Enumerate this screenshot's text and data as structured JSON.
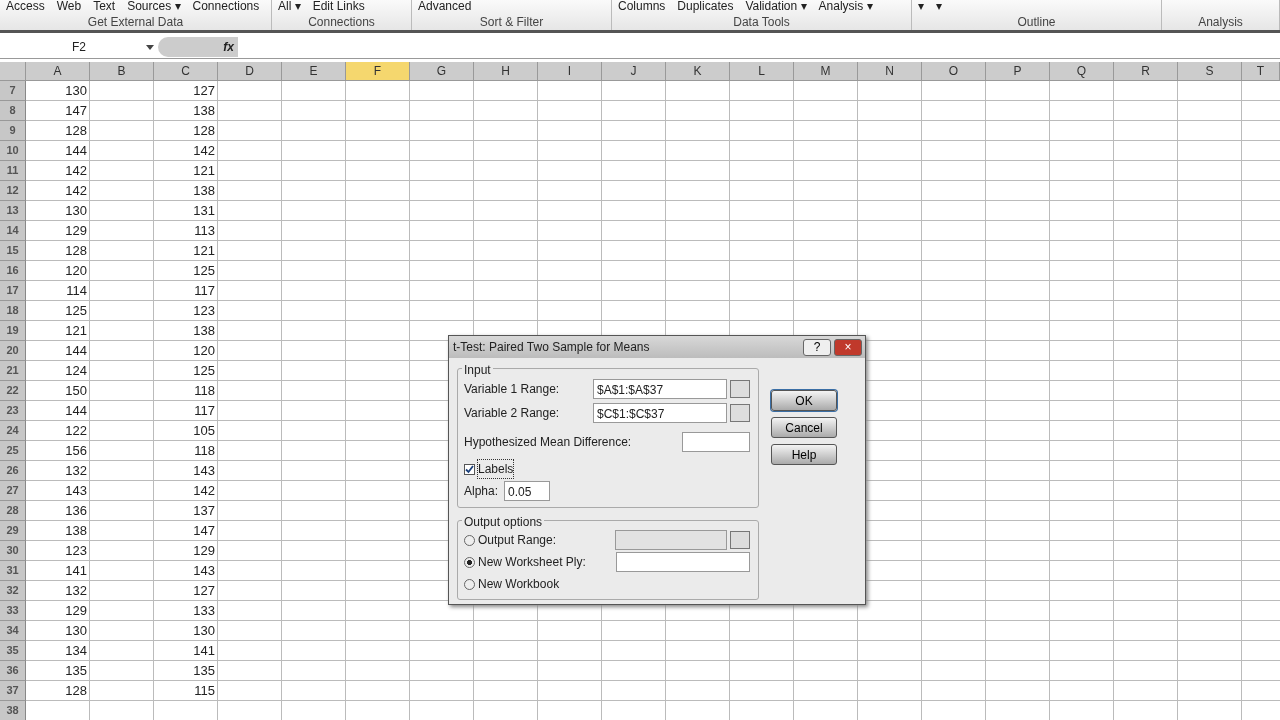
{
  "ribbon": {
    "groups": [
      {
        "label": "Get External Data",
        "items": [
          "Access",
          "Web",
          "Text",
          "Sources ▾",
          "Connections"
        ]
      },
      {
        "label": "Connections",
        "items": [
          "All ▾",
          "Edit Links"
        ]
      },
      {
        "label": "Sort & Filter",
        "items": [
          "Advanced"
        ]
      },
      {
        "label": "Data Tools",
        "items": [
          "Columns",
          "Duplicates",
          "Validation ▾",
          "Analysis ▾"
        ]
      },
      {
        "label": "Outline",
        "items": [
          "▾",
          "▾"
        ]
      },
      {
        "label": "Analysis"
      }
    ]
  },
  "formula_bar": {
    "name_box": "F2",
    "function_button": "fx"
  },
  "sheet": {
    "columns": [
      {
        "label": "A",
        "selected": false
      },
      {
        "label": "B",
        "selected": false
      },
      {
        "label": "C",
        "selected": false
      },
      {
        "label": "D",
        "selected": false
      },
      {
        "label": "E",
        "selected": false
      },
      {
        "label": "F",
        "selected": true
      },
      {
        "label": "G",
        "selected": false
      },
      {
        "label": "H",
        "selected": false
      },
      {
        "label": "I",
        "selected": false
      },
      {
        "label": "J",
        "selected": false
      },
      {
        "label": "K",
        "selected": false
      },
      {
        "label": "L",
        "selected": false
      },
      {
        "label": "M",
        "selected": false
      },
      {
        "label": "N",
        "selected": false
      },
      {
        "label": "O",
        "selected": false
      },
      {
        "label": "P",
        "selected": false
      },
      {
        "label": "Q",
        "selected": false
      },
      {
        "label": "R",
        "selected": false
      },
      {
        "label": "S",
        "selected": false
      },
      {
        "label": "T",
        "selected": false
      }
    ],
    "rows": [
      {
        "number": "7",
        "a": "130",
        "c": "127"
      },
      {
        "number": "8",
        "a": "147",
        "c": "138"
      },
      {
        "number": "9",
        "a": "128",
        "c": "128"
      },
      {
        "number": "10",
        "a": "144",
        "c": "142"
      },
      {
        "number": "11",
        "a": "142",
        "c": "121"
      },
      {
        "number": "12",
        "a": "142",
        "c": "138"
      },
      {
        "number": "13",
        "a": "130",
        "c": "131"
      },
      {
        "number": "14",
        "a": "129",
        "c": "113"
      },
      {
        "number": "15",
        "a": "128",
        "c": "121"
      },
      {
        "number": "16",
        "a": "120",
        "c": "125"
      },
      {
        "number": "17",
        "a": "114",
        "c": "117"
      },
      {
        "number": "18",
        "a": "125",
        "c": "123"
      },
      {
        "number": "19",
        "a": "121",
        "c": "138"
      },
      {
        "number": "20",
        "a": "144",
        "c": "120"
      },
      {
        "number": "21",
        "a": "124",
        "c": "125"
      },
      {
        "number": "22",
        "a": "150",
        "c": "118"
      },
      {
        "number": "23",
        "a": "144",
        "c": "117"
      },
      {
        "number": "24",
        "a": "122",
        "c": "105"
      },
      {
        "number": "25",
        "a": "156",
        "c": "118"
      },
      {
        "number": "26",
        "a": "132",
        "c": "143"
      },
      {
        "number": "27",
        "a": "143",
        "c": "142"
      },
      {
        "number": "28",
        "a": "136",
        "c": "137"
      },
      {
        "number": "29",
        "a": "138",
        "c": "147"
      },
      {
        "number": "30",
        "a": "123",
        "c": "129"
      },
      {
        "number": "31",
        "a": "141",
        "c": "143"
      },
      {
        "number": "32",
        "a": "132",
        "c": "127"
      },
      {
        "number": "33",
        "a": "129",
        "c": "133"
      },
      {
        "number": "34",
        "a": "130",
        "c": "130"
      },
      {
        "number": "35",
        "a": "134",
        "c": "141"
      },
      {
        "number": "36",
        "a": "135",
        "c": "135"
      },
      {
        "number": "37",
        "a": "128",
        "c": "115"
      },
      {
        "number": "38"
      }
    ]
  },
  "dialog": {
    "title": "t-Test: Paired Two Sample for Means",
    "help_button": "?",
    "close_button": "×",
    "input": {
      "legend": "Input",
      "ranges": [
        {
          "label": "Variable 1 Range:",
          "value": "$A$1:$A$37"
        },
        {
          "label": "Variable 2 Range:",
          "value": "$C$1:$C$37"
        }
      ],
      "difference_label": "Hypothesized Mean Difference:",
      "labels_checkbox": {
        "label": "Labels",
        "checked": true
      },
      "alpha": {
        "label": "Alpha:",
        "value": "0.05"
      }
    },
    "output": {
      "legend": "Output options",
      "options": [
        {
          "label": "Output Range:",
          "selected": false,
          "kind": "range"
        },
        {
          "label": "New Worksheet Ply:",
          "selected": true,
          "kind": "field"
        },
        {
          "label": "New Workbook",
          "selected": false,
          "kind": "plain"
        }
      ]
    },
    "buttons": [
      "OK",
      "Cancel",
      "Help"
    ]
  }
}
